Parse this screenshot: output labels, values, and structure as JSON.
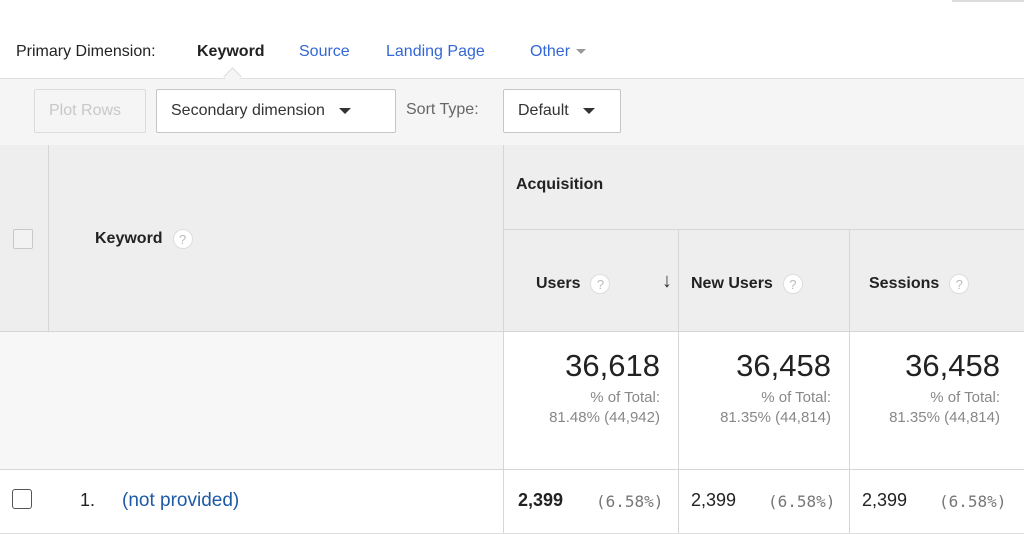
{
  "dimensions": {
    "label": "Primary Dimension:",
    "options": [
      "Keyword",
      "Source",
      "Landing Page",
      "Other"
    ],
    "active": "Keyword"
  },
  "toolbar": {
    "plot_rows": "Plot Rows",
    "secondary_dimension": "Secondary dimension",
    "sort_type_label": "Sort Type:",
    "sort_type_value": "Default"
  },
  "table": {
    "keyword_header": "Keyword",
    "group_header": "Acquisition",
    "columns": [
      "Users",
      "New Users",
      "Sessions"
    ],
    "help_glyph": "?",
    "sort_indicator": "↓",
    "totals": [
      {
        "value": "36,618",
        "pct_label": "% of Total:",
        "pct_detail": "81.48% (44,942)"
      },
      {
        "value": "36,458",
        "pct_label": "% of Total:",
        "pct_detail": "81.35% (44,814)"
      },
      {
        "value": "36,458",
        "pct_label": "% of Total:",
        "pct_detail": "81.35% (44,814)"
      }
    ],
    "rows": [
      {
        "index": "1.",
        "keyword": "(not provided)",
        "values": [
          {
            "value": "2,399",
            "pct": "(6.58%)"
          },
          {
            "value": "2,399",
            "pct": "(6.58%)"
          },
          {
            "value": "2,399",
            "pct": "(6.58%)"
          }
        ]
      }
    ]
  },
  "colors": {
    "link": "#3367d6",
    "header_bg": "#eeeeee",
    "toolbar_bg": "#f5f5f5"
  }
}
